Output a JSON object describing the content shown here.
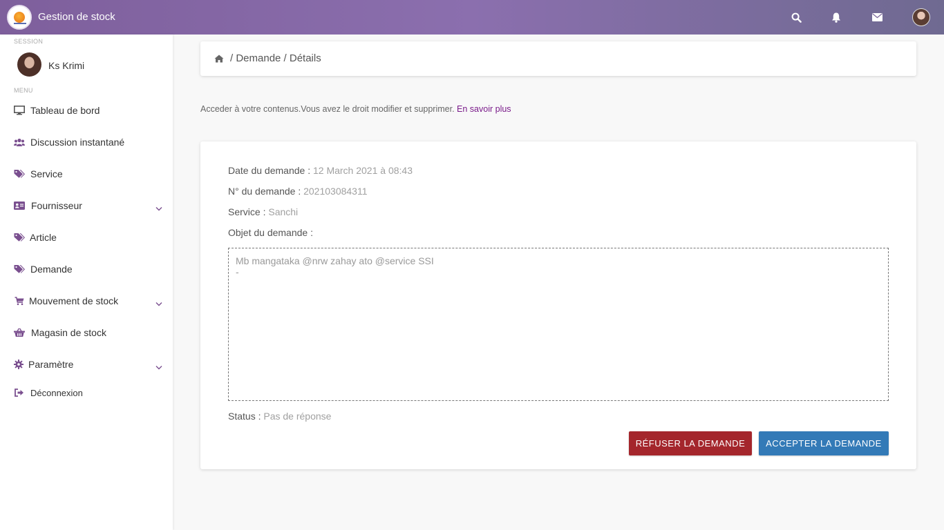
{
  "header": {
    "title": "Gestion de stock"
  },
  "sidebar": {
    "session_label": "SESSION",
    "user_name": "Ks Krimi",
    "menu_label": "MENU",
    "items": [
      {
        "label": "Tableau de bord",
        "icon": "monitor-icon"
      },
      {
        "label": "Discussion instantané",
        "icon": "users-icon"
      },
      {
        "label": "Service",
        "icon": "tags-icon"
      },
      {
        "label": "Fournisseur",
        "icon": "id-card-icon",
        "expandable": true
      },
      {
        "label": "Article",
        "icon": "tags-icon"
      },
      {
        "label": "Demande",
        "icon": "tags-icon"
      },
      {
        "label": "Mouvement de stock",
        "icon": "cart-icon",
        "expandable": true
      },
      {
        "label": "Magasin de stock",
        "icon": "basket-icon"
      },
      {
        "label": "Paramètre",
        "icon": "gear-icon",
        "expandable": true
      },
      {
        "label": "Déconnexion",
        "icon": "sign-out-icon"
      }
    ]
  },
  "breadcrumb": {
    "text": "/ Demande / Détails"
  },
  "info": {
    "text": "Acceder à votre contenus.Vous avez le droit modifier et supprimer.",
    "link": "En savoir plus"
  },
  "details": {
    "date_label": "Date du demande : ",
    "date_value": "12 March 2021 à 08:43",
    "number_label": "N° du demande : ",
    "number_value": "202103084311",
    "service_label": "Service : ",
    "service_value": "Sanchi",
    "objet_label": "Objet du demande :",
    "objet_line1": "Mb mangataka @nrw zahay ato @service SSI",
    "objet_line2": "-",
    "status_label": "Status : ",
    "status_value": "Pas de réponse"
  },
  "actions": {
    "refuse": "RÉFUSER LA DEMANDE",
    "accept": "ACCEPTER LA DEMANDE"
  },
  "colors": {
    "accent": "#7a4f8f",
    "refuse": "#a4262c",
    "accept": "#337ab7"
  }
}
